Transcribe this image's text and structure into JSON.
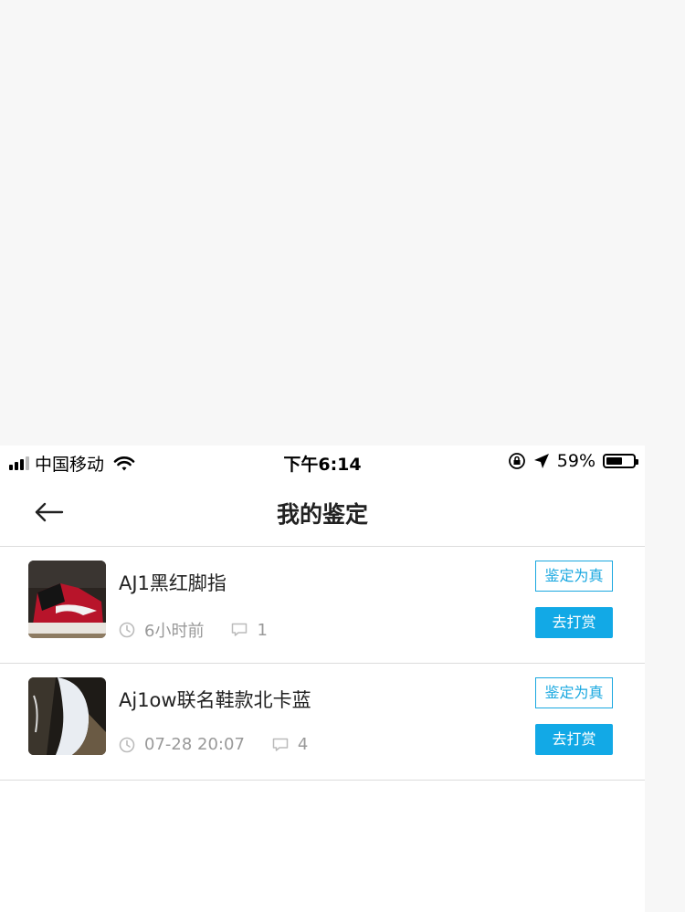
{
  "status_bar": {
    "carrier": "中国移动",
    "time": "下午6:14",
    "battery": "59%",
    "battery_level": 0.59,
    "icons": [
      "signal-icon",
      "wifi-icon",
      "rotation-lock-icon",
      "location-icon",
      "battery-icon"
    ]
  },
  "nav": {
    "title": "我的鉴定",
    "back_icon": "arrow-left-icon"
  },
  "items": [
    {
      "title": "AJ1黑红脚指",
      "time": "6小时前",
      "comments": "1",
      "status": "鉴定为真",
      "action": "去打赏"
    },
    {
      "title": "Aj1ow联名鞋款北卡蓝",
      "time": "07-28 20:07",
      "comments": "4",
      "status": "鉴定为真",
      "action": "去打赏"
    }
  ],
  "colors": {
    "accent": "#12a9e6",
    "page_bg": "#f7f7f7",
    "divider": "#dcdcdc",
    "meta_text": "#999999"
  }
}
